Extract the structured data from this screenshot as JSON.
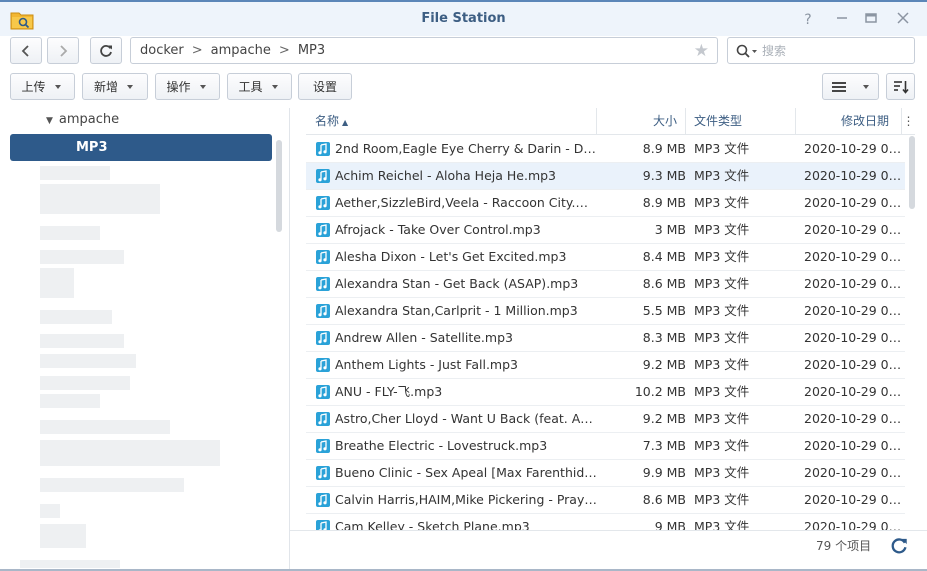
{
  "window": {
    "title": "File Station"
  },
  "icons": {
    "app": "folder-search-icon",
    "help": "help-icon",
    "minimize": "minimize-icon",
    "maximize": "maximize-icon",
    "close": "close-icon",
    "back": "chevron-left-icon",
    "forward": "chevron-right-icon",
    "refresh": "refresh-icon",
    "bookmark": "star-icon",
    "search": "search-icon",
    "list_view": "list-view-icon",
    "sort": "sort-icon",
    "file": "music-file-icon"
  },
  "path": {
    "segments": [
      "docker",
      "ampache",
      "MP3"
    ],
    "separator": ">"
  },
  "search": {
    "placeholder": "搜索"
  },
  "toolbar": {
    "upload": "上传",
    "create": "新增",
    "action": "操作",
    "tools": "工具",
    "settings": "设置"
  },
  "tree": {
    "parent": "ampache",
    "selected": "MP3"
  },
  "columns": {
    "name": "名称",
    "size": "大小",
    "type": "文件类型",
    "modified": "修改日期"
  },
  "files": [
    {
      "name": "2nd Room,Eagle Eye Cherry & Darin - Dr...",
      "size": "8.9 MB",
      "type": "MP3 文件",
      "modified": "2020-10-29 09..."
    },
    {
      "name": "Achim Reichel - Aloha Heja He.mp3",
      "size": "9.3 MB",
      "type": "MP3 文件",
      "modified": "2020-10-29 09..."
    },
    {
      "name": "Aether,SizzleBird,Veela - Raccoon City.mp3",
      "size": "8.9 MB",
      "type": "MP3 文件",
      "modified": "2020-10-29 09..."
    },
    {
      "name": "Afrojack - Take Over Control.mp3",
      "size": "3 MB",
      "type": "MP3 文件",
      "modified": "2020-10-29 09..."
    },
    {
      "name": "Alesha Dixon - Let's Get Excited.mp3",
      "size": "8.4 MB",
      "type": "MP3 文件",
      "modified": "2020-10-29 09..."
    },
    {
      "name": "Alexandra Stan - Get Back (ASAP).mp3",
      "size": "8.6 MB",
      "type": "MP3 文件",
      "modified": "2020-10-29 09..."
    },
    {
      "name": "Alexandra Stan,Carlprit - 1 Million.mp3",
      "size": "5.5 MB",
      "type": "MP3 文件",
      "modified": "2020-10-29 09..."
    },
    {
      "name": "Andrew Allen - Satellite.mp3",
      "size": "8.3 MB",
      "type": "MP3 文件",
      "modified": "2020-10-29 09..."
    },
    {
      "name": "Anthem Lights - Just Fall.mp3",
      "size": "9.2 MB",
      "type": "MP3 文件",
      "modified": "2020-10-29 09..."
    },
    {
      "name": "ANU - FLY-飞.mp3",
      "size": "10.2 MB",
      "type": "MP3 文件",
      "modified": "2020-10-29 09..."
    },
    {
      "name": "Astro,Cher Lloyd - Want U Back (feat. As...",
      "size": "9.2 MB",
      "type": "MP3 文件",
      "modified": "2020-10-29 09..."
    },
    {
      "name": "Breathe Electric - Lovestruck.mp3",
      "size": "7.3 MB",
      "type": "MP3 文件",
      "modified": "2020-10-29 09..."
    },
    {
      "name": "Bueno Clinic - Sex Apeal [Max Farenthide...",
      "size": "9.9 MB",
      "type": "MP3 文件",
      "modified": "2020-10-29 09..."
    },
    {
      "name": "Calvin Harris,HAIM,Mike Pickering - Pray ...",
      "size": "8.6 MB",
      "type": "MP3 文件",
      "modified": "2020-10-29 09..."
    },
    {
      "name": "Cam Kelley - Sketch Plane.mp3",
      "size": "9 MB",
      "type": "MP3 文件",
      "modified": "2020-10-29 09..."
    }
  ],
  "footer": {
    "count": "79 个项目"
  }
}
